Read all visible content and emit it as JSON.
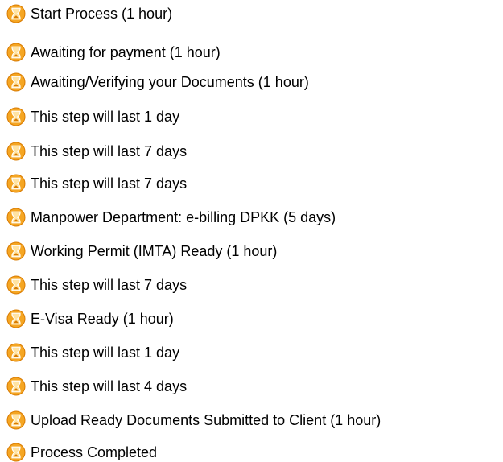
{
  "process_steps": {
    "icon": "hourglass-icon",
    "colors": {
      "icon_fill": "#F5A623",
      "icon_dark": "#D97B00",
      "icon_light": "#FFE3A3",
      "text": "#000000"
    },
    "items": [
      {
        "label": "Start Process (1 hour)"
      },
      {
        "label": "Awaiting for payment (1 hour)"
      },
      {
        "label": "Awaiting/Verifying your Documents (1 hour)"
      },
      {
        "label": "This step will last 1 day"
      },
      {
        "label": "This step will last 7 days"
      },
      {
        "label": "This step will last 7 days"
      },
      {
        "label": "Manpower Department: e-billing DPKK (5 days)"
      },
      {
        "label": "Working Permit (IMTA) Ready (1 hour)"
      },
      {
        "label": "This step will last 7 days"
      },
      {
        "label": "E-Visa Ready (1 hour)"
      },
      {
        "label": "This step will last 1 day"
      },
      {
        "label": "This step will last 4 days"
      },
      {
        "label": "Upload Ready Documents Submitted to Client (1 hour)"
      },
      {
        "label": "Process Completed"
      }
    ]
  }
}
